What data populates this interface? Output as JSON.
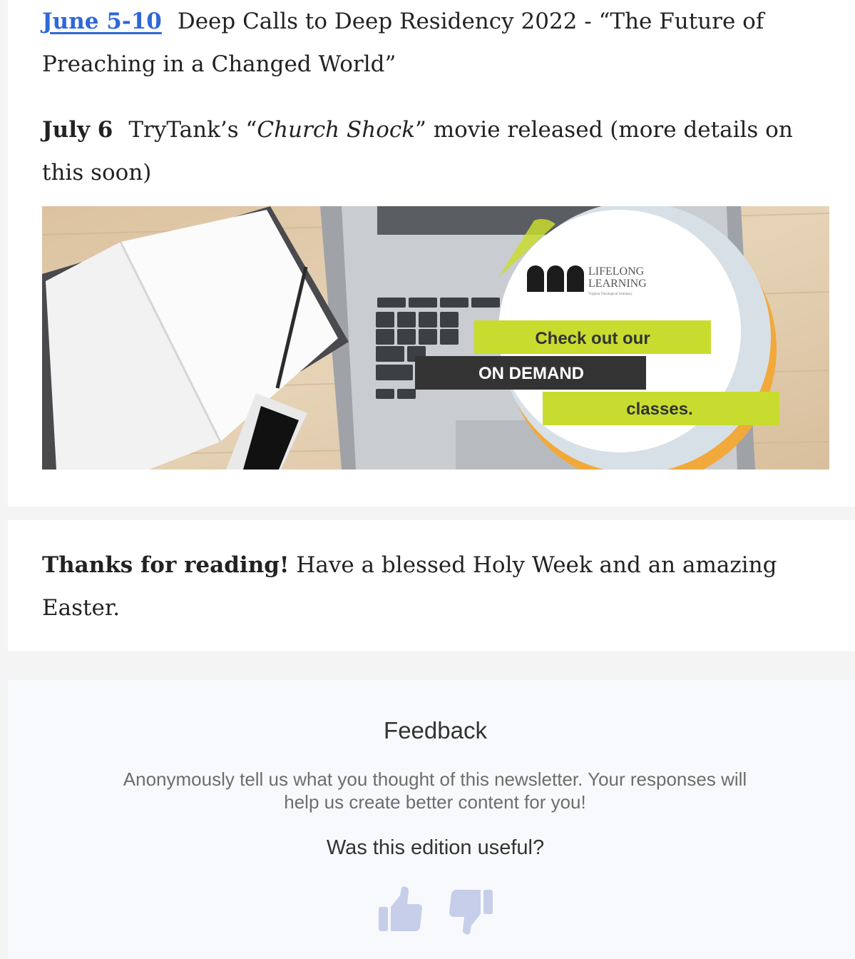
{
  "events": [
    {
      "date": "June 5-10",
      "date_is_link": true,
      "description": "Deep Calls to Deep Residency 2022 - “The Future of Preaching in a Changed World”"
    },
    {
      "date": "July 6",
      "date_is_link": false,
      "desc_pre": "TryTank’s “",
      "desc_italic": "Church Shock",
      "desc_post": "” movie released (more details on this soon)"
    }
  ],
  "promo_banner": {
    "logo_line1": "LIFELONG",
    "logo_line2": "LEARNING",
    "logo_tagline": "Virginia Theological Seminary",
    "line1": "Check out our",
    "line2": "ON DEMAND",
    "line3": "classes.",
    "accent_color": "#c8dc2f",
    "dark_color": "#333333"
  },
  "thanks": {
    "bold": "Thanks for reading!",
    "text": " Have a blessed Holy Week and an amazing Easter."
  },
  "feedback": {
    "title": "Feedback",
    "description": "Anonymously tell us what you thought of this newsletter. Your responses will help us create better content for you!",
    "question": "Was this edition useful?",
    "thumbs_up_icon": "thumbs-up-icon",
    "thumbs_down_icon": "thumbs-down-icon",
    "icon_color": "#c6cee9"
  },
  "colors": {
    "link": "#2f67d8",
    "feedback_bg": "#f8f9fc",
    "page_bg": "#f4f4f4"
  }
}
